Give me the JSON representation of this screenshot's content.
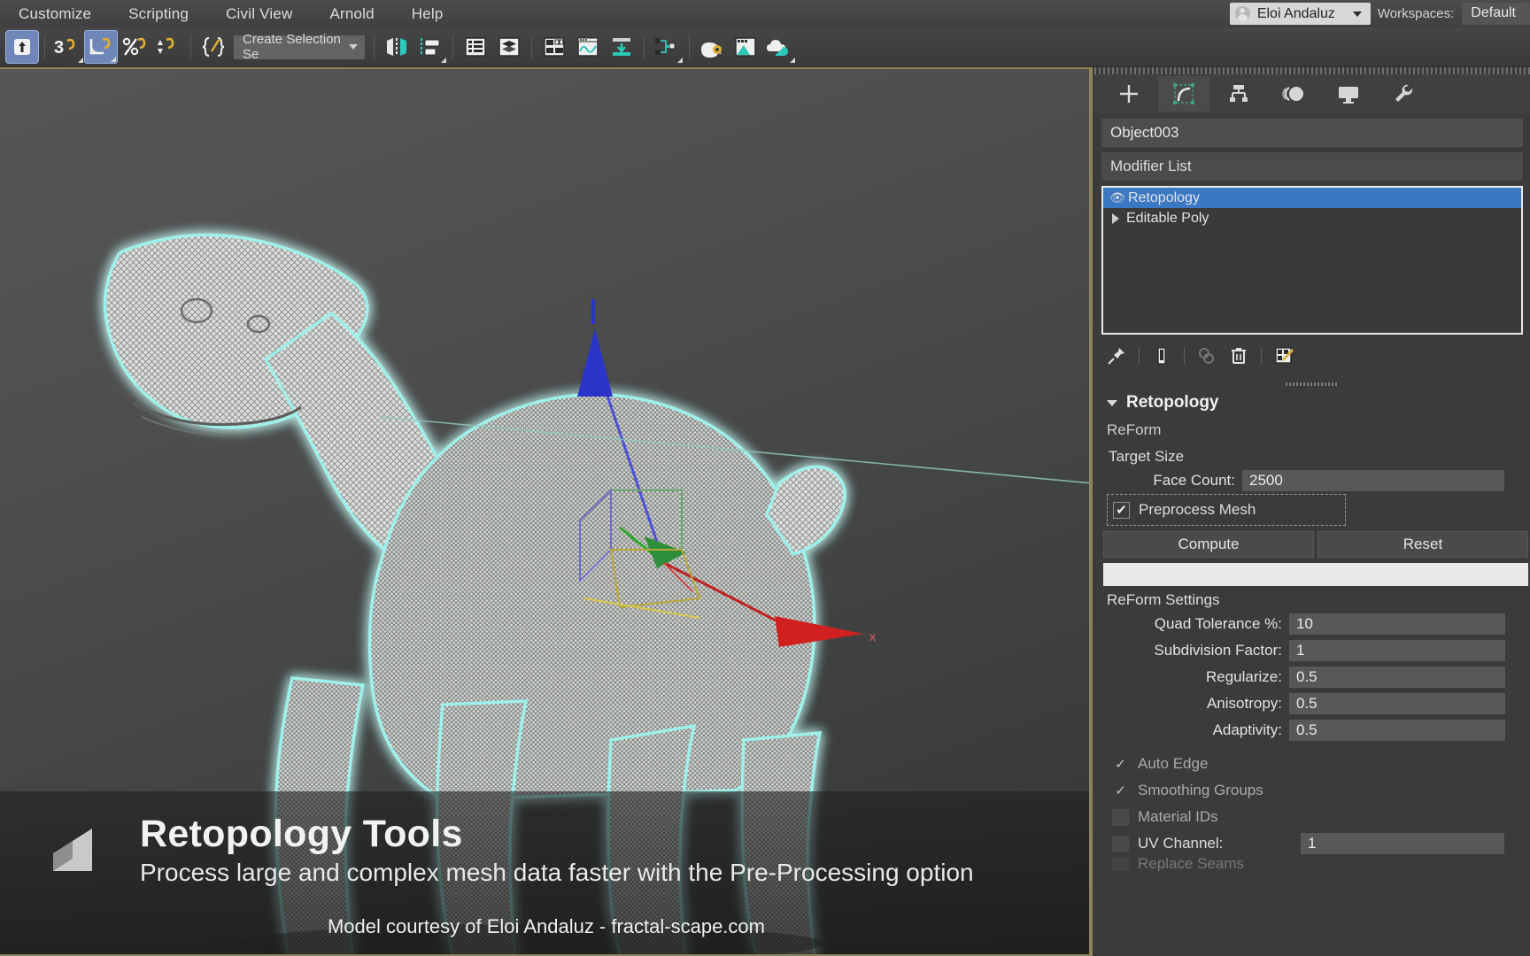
{
  "menu": {
    "items": [
      "Customize",
      "Scripting",
      "Civil View",
      "Arnold",
      "Help"
    ],
    "user_name": "Eloi Andaluz",
    "workspaces_label": "Workspaces:",
    "workspace_value": "Default"
  },
  "toolbar": {
    "selection_set": "Create Selection Se",
    "icons": [
      "select-object-icon",
      "select-by-name-icon",
      "angle-snap-icon",
      "percent-snap-icon",
      "spinner-snap-icon",
      "named-selection-sets-icon",
      "mirror-icon",
      "align-icon",
      "layer-explorer-icon",
      "layer-manager-icon",
      "compact-material-editor-icon",
      "curve-editor-icon",
      "render-setup-icon",
      "schematic-view-icon",
      "render-production-icon",
      "rendered-frame-window-icon",
      "render-in-cloud-icon"
    ]
  },
  "command_panel": {
    "tabs": [
      {
        "name": "create-tab",
        "icon": "plus-icon",
        "active": false
      },
      {
        "name": "modify-tab",
        "icon": "modify-bent-icon",
        "active": true
      },
      {
        "name": "hierarchy-tab",
        "icon": "hierarchy-icon",
        "active": false
      },
      {
        "name": "motion-tab",
        "icon": "motion-wheel-icon",
        "active": false
      },
      {
        "name": "display-tab",
        "icon": "display-monitor-icon",
        "active": false
      },
      {
        "name": "utilities-tab",
        "icon": "wrench-icon",
        "active": false
      }
    ],
    "object_name": "Object003",
    "modifier_list_label": "Modifier List",
    "stack": [
      {
        "label": "Retopology",
        "selected": true,
        "has_eye": true,
        "has_arrow": false
      },
      {
        "label": "Editable Poly",
        "selected": false,
        "has_eye": false,
        "has_arrow": true
      }
    ],
    "stack_tools": [
      "pin-stack-icon",
      "show-end-result-icon",
      "make-unique-icon",
      "remove-modifier-icon",
      "configure-modifier-sets-icon"
    ]
  },
  "retopology": {
    "rollout_title": "Retopology",
    "algorithm": "ReForm",
    "target_size_label": "Target Size",
    "face_count_label": "Face Count:",
    "face_count_value": "2500",
    "preprocess_label": "Preprocess Mesh",
    "preprocess_checked": true,
    "compute_label": "Compute",
    "reset_label": "Reset",
    "settings_title": "ReForm Settings",
    "settings": [
      {
        "label": "Quad Tolerance %:",
        "value": "10"
      },
      {
        "label": "Subdivision Factor:",
        "value": "1"
      },
      {
        "label": "Regularize:",
        "value": "0.5"
      },
      {
        "label": "Anisotropy:",
        "value": "0.5"
      },
      {
        "label": "Adaptivity:",
        "value": "0.5"
      }
    ],
    "options": [
      {
        "label": "Auto Edge",
        "checked": true,
        "dim": true
      },
      {
        "label": "Smoothing Groups",
        "checked": true,
        "dim": true
      },
      {
        "label": "Material IDs",
        "checked": false,
        "dim": true
      },
      {
        "label": "UV Channel:",
        "checked": false,
        "dim": false,
        "value": "1"
      }
    ],
    "bottom_partial": "Replace Seams"
  },
  "banner": {
    "title": "Retopology Tools",
    "subtitle": "Process large and complex mesh data faster with the Pre-Processing option",
    "credit": "Model courtesy of Eloi Andaluz - fractal-scape.com"
  },
  "colors": {
    "accent_selection": "#3b78c3",
    "viewport_border": "#8a8456",
    "mesh_glow": "#7ef0ea",
    "gizmo_x": "#d02020",
    "gizmo_y": "#2ba82b",
    "gizmo_z": "#2a34c8"
  }
}
